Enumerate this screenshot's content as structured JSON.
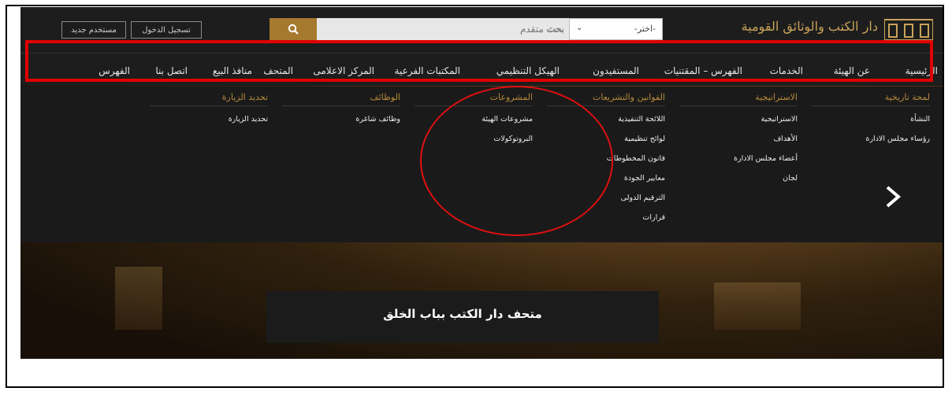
{
  "header": {
    "new_user": "مستخدم جديد",
    "login": "تسجيل الدخول",
    "search_placeholder": "بحث متقدم",
    "search_label": "بحث",
    "select_value": "-اختر-",
    "logo_text": "دار الكتب والوثائق القومية"
  },
  "nav": {
    "items": [
      "الرئيسية",
      "عن الهيئة",
      "الخدمات",
      "الفهرس – المقتنيات",
      "المستفيدون",
      "الهيكل التنظيمي",
      "المكتبات الفرعية",
      "المركز الاعلامى",
      "المتحف",
      "منافذ البيع",
      "اتصل بنا",
      "الفهرس"
    ]
  },
  "menu": {
    "columns": [
      {
        "title": "لمحة تاريخية",
        "items": [
          "النشأة",
          "رؤساء مجلس الادارة"
        ]
      },
      {
        "title": "الاستراتيجية",
        "items": [
          "الاستراتيجية",
          "الأهداف",
          "أعضاء مجلس الادارة",
          "لجان"
        ]
      },
      {
        "title": "القوانين والتشريعات",
        "items": [
          "اللائحة التنفيذية",
          "لوائح تنظيمية",
          "قانون المخطوطات",
          "معايير الجودة",
          "الترقيم الدولى",
          "قرارات"
        ]
      },
      {
        "title": "المشروعات",
        "items": [
          "مشروعات الهيئة",
          "البروتوكولات"
        ]
      },
      {
        "title": "الوظائف",
        "items": [
          "وظائف شاغرة"
        ]
      },
      {
        "title": "تحديد الزيارة",
        "items": [
          "تحديد الزيارة"
        ]
      }
    ]
  },
  "slider": {
    "caption": "متحف دار الكتب بباب الخلق"
  },
  "colors": {
    "accent": "#b68a3a",
    "search_button": "#a57a2f",
    "annotation": "#e00000"
  },
  "icons": {
    "search": "search-icon",
    "next": "chevron-right-icon",
    "select": "chevron-down-icon"
  }
}
